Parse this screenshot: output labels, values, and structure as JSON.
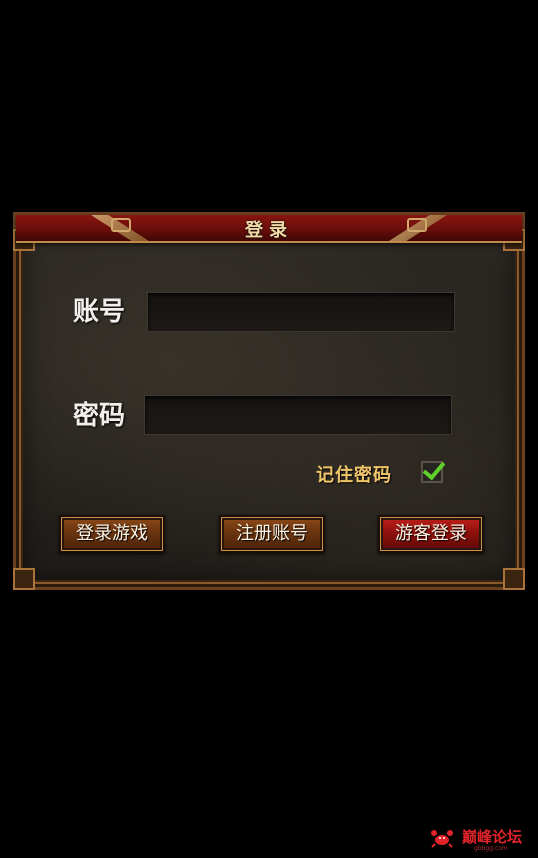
{
  "dialog": {
    "title": "登录"
  },
  "form": {
    "account_label": "账号",
    "account_value": "",
    "password_label": "密码",
    "password_value": "",
    "remember_label": "记住密码",
    "remember_checked": true
  },
  "buttons": {
    "login_label": "登录游戏",
    "register_label": "注册账号",
    "guest_label": "游客登录"
  },
  "watermark": {
    "text": "巅峰论坛",
    "subtext": "gbbgg.com",
    "icon": "crab-icon"
  },
  "colors": {
    "title_red": "#8a1410",
    "frame_gold": "#c08a4a",
    "remember_gold": "#f1c66a",
    "check_green": "#5fcf2a",
    "button_brown": "#6a3410",
    "button_red": "#8a100c",
    "watermark_red": "#e0242a"
  }
}
